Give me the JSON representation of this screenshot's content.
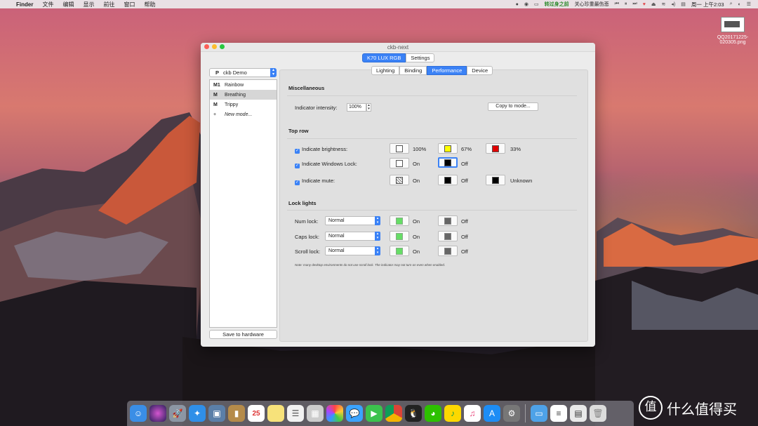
{
  "menubar": {
    "apple": "",
    "app": "Finder",
    "items": [
      "文件",
      "编辑",
      "显示",
      "前往",
      "窗口",
      "帮助"
    ],
    "tray_text": "转过身之前",
    "song": "关心珍重最伤悲",
    "clock": "周一 上午2:03"
  },
  "desktop_file": {
    "name": "QQ20171225-020305.png"
  },
  "window": {
    "title": "ckb-next",
    "top_tabs": [
      "K70 LUX RGB",
      "Settings"
    ],
    "profile": {
      "letter": "P",
      "name": "ckb Demo"
    },
    "modes": [
      {
        "letter": "M1",
        "name": "Rainbow"
      },
      {
        "letter": "M",
        "name": "Breathing"
      },
      {
        "letter": "M",
        "name": "Trippy"
      }
    ],
    "new_mode": "New mode...",
    "new_mode_symbol": "+",
    "save_button": "Save to hardware",
    "sub_tabs": [
      "Lighting",
      "Binding",
      "Performance",
      "Device"
    ],
    "misc": {
      "title": "Miscellaneous",
      "intensity_label": "Indicator intensity:",
      "intensity_value": "100%",
      "copy_button": "Copy to mode..."
    },
    "top_row": {
      "title": "Top row",
      "brightness": {
        "label": "Indicate brightness:",
        "v1": "100%",
        "v2": "67%",
        "v3": "33%",
        "c1": "#ffffff",
        "c2": "#ffff00",
        "c3": "#e00000"
      },
      "winlock": {
        "label": "Indicate Windows Lock:",
        "on": "On",
        "off": "Off",
        "c_on": "#ffffff",
        "c_off": "#000000"
      },
      "mute": {
        "label": "Indicate mute:",
        "on": "On",
        "off": "Off",
        "unknown": "Unknown",
        "c_off": "#000000",
        "c_unknown": "#000000"
      }
    },
    "lock_lights": {
      "title": "Lock lights",
      "rows": [
        {
          "label": "Num lock:",
          "mode": "Normal",
          "on": "On",
          "off": "Off"
        },
        {
          "label": "Caps lock:",
          "mode": "Normal",
          "on": "On",
          "off": "Off"
        },
        {
          "label": "Scroll lock:",
          "mode": "Normal",
          "on": "On",
          "off": "Off"
        }
      ],
      "on_color": "#66dd66",
      "off_color": "#666666",
      "note": "Note: many desktop environments do not use scroll lock. The indicator may not turn on even when enabled."
    }
  },
  "dock": {
    "calendar_day": "25",
    "apps": [
      "finder-icon",
      "siri-icon",
      "launchpad-icon",
      "safari-icon",
      "preview-icon",
      "contacts-icon",
      "calendar-icon",
      "notes-icon",
      "reminders-icon",
      "photo-booth-icon",
      "photos-icon",
      "messages-icon",
      "facetime-icon",
      "chrome-icon",
      "qq-icon",
      "wechat-icon",
      "qq-music-icon",
      "itunes-icon",
      "app-store-icon",
      "system-preferences-icon",
      "folder-icon",
      "file-icon",
      "screenshot-icon",
      "trash-icon"
    ]
  },
  "watermark": {
    "text": "什么值得买",
    "logo": "值"
  }
}
